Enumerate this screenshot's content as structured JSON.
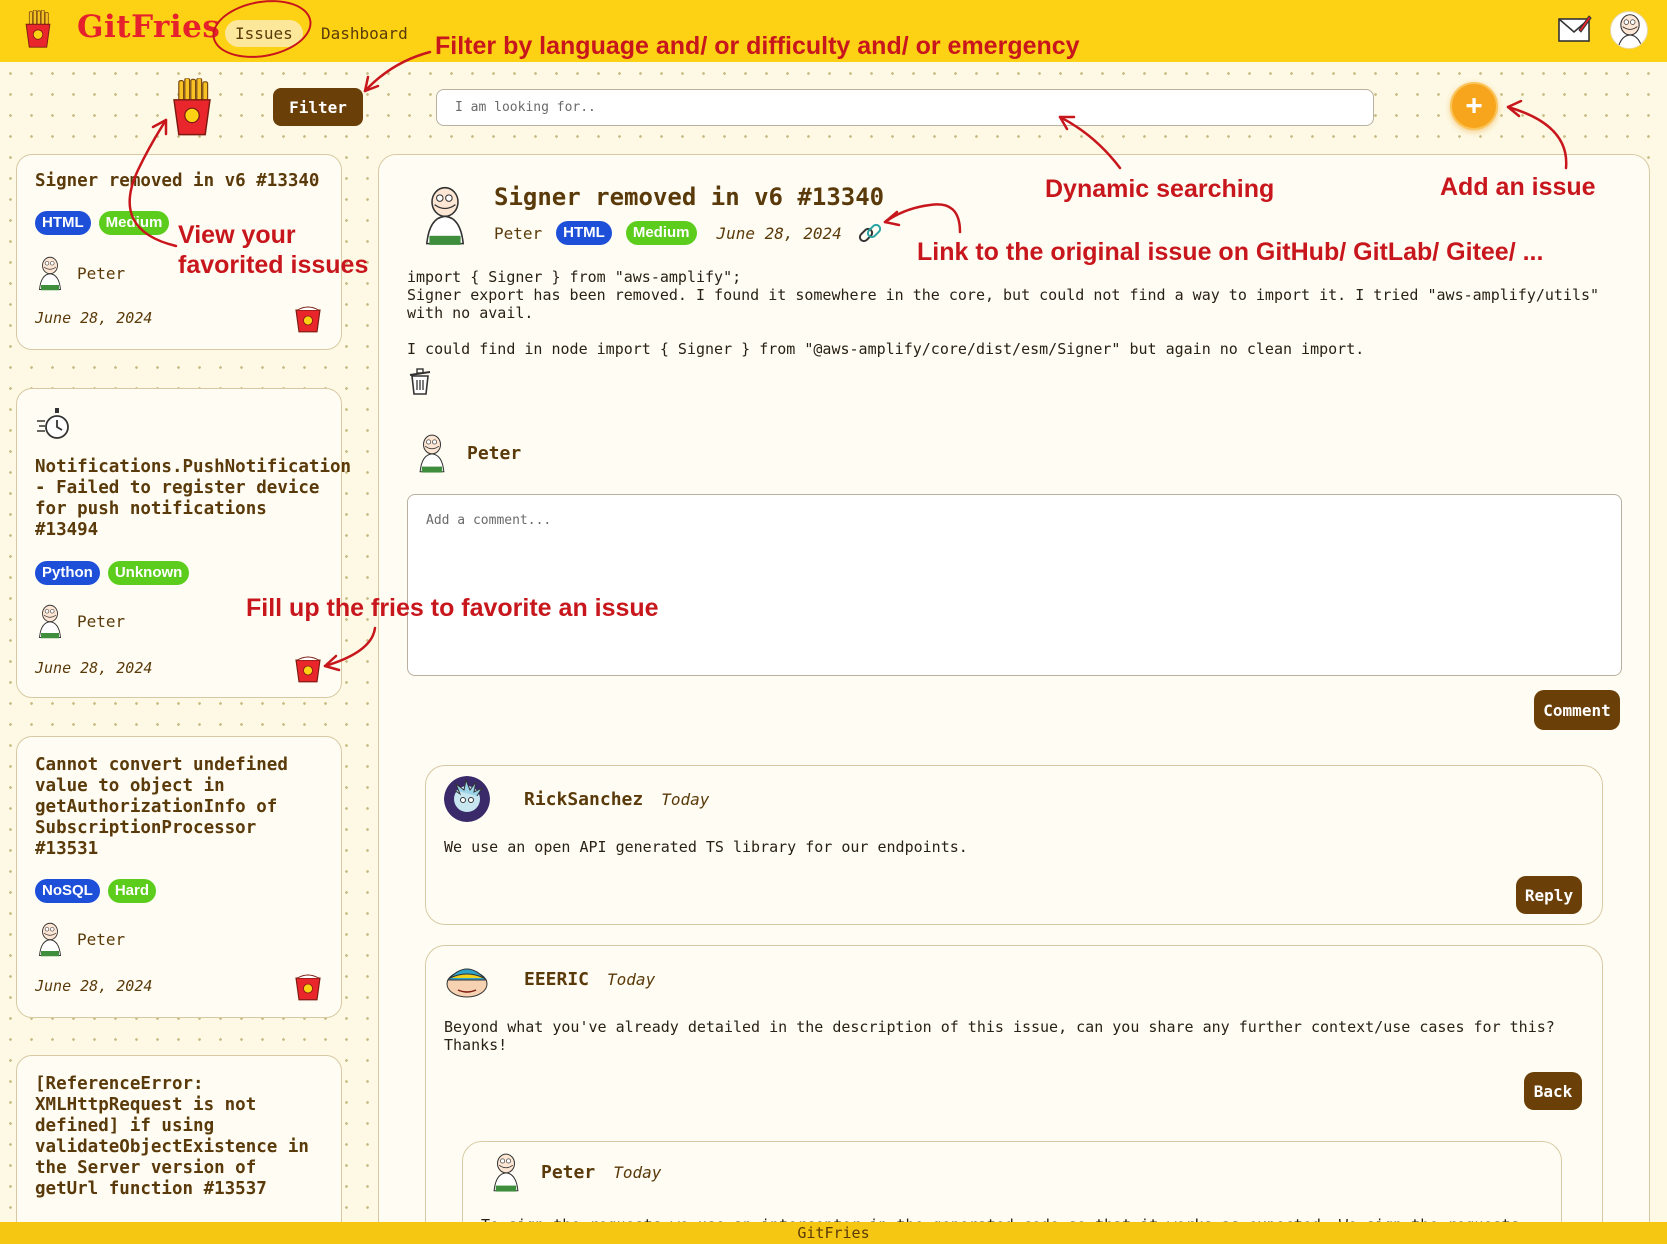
{
  "app": {
    "name": "GitFries"
  },
  "nav": {
    "tabs": [
      {
        "label": "Issues",
        "active": true
      },
      {
        "label": "Dashboard",
        "active": false
      }
    ]
  },
  "toolbar": {
    "filter_label": "Filter",
    "search_placeholder": "I am looking for..",
    "add_label": "+"
  },
  "issue_list": [
    {
      "title": "Signer removed in v6 #13340",
      "language": "HTML",
      "difficulty": "Medium",
      "author": "Peter",
      "date": "June 28, 2024"
    },
    {
      "title": "Notifications.PushNotification - Failed to register device for push notifications #13494",
      "language": "Python",
      "difficulty": "Unknown",
      "author": "Peter",
      "date": "June 28, 2024"
    },
    {
      "title": "Cannot convert undefined value to object in getAuthorizationInfo of SubscriptionProcessor #13531",
      "language": "NoSQL",
      "difficulty": "Hard",
      "author": "Peter",
      "date": "June 28, 2024"
    },
    {
      "title": "[ReferenceError: XMLHttpRequest is not defined] if using validateObjectExistence in the Server version of getUrl function #13537"
    }
  ],
  "issue": {
    "title": "Signer removed in v6 #13340",
    "author": "Peter",
    "language": "HTML",
    "difficulty": "Medium",
    "date": "June 28, 2024",
    "body": "import { Signer } from \"aws-amplify\";\nSigner export has been removed. I found it somewhere in the core, but could not find a way to import it. I tried \"aws-amplify/utils\"\nwith no avail.\n\nI could find in node import { Signer } from \"@aws-amplify/core/dist/esm/Signer\" but again no clean import."
  },
  "comment_form": {
    "user": "Peter",
    "placeholder": "Add a comment...",
    "submit_label": "Comment"
  },
  "comments": [
    {
      "author": "RickSanchez",
      "when": "Today",
      "text": "We use an open API generated TS library for our endpoints.",
      "action_label": "Reply"
    },
    {
      "author": "EEERIC",
      "when": "Today",
      "text": "Beyond what you've already detailed in the description of this issue, can you share any further context/use cases for this?\nThanks!",
      "action_label": "Back",
      "replies": [
        {
          "author": "Peter",
          "when": "Today",
          "text": "To sign the requests we use an interceptor in the generated code so that it works as expected. We sign the requests"
        }
      ]
    }
  ],
  "annotations": {
    "filter": "Filter by language and/ or difficulty and/ or emergency",
    "search": "Dynamic searching",
    "add": "Add an issue",
    "favorites_line1": "View your",
    "favorites_line2": "favorited issues",
    "link": "Link to the original issue on GitHub/ GitLab/ Gitee/ ...",
    "fill": "Fill up the fries to favorite an issue"
  },
  "footer": {
    "text": "GitFries"
  },
  "colors": {
    "topbar": "#fdd214",
    "brand_red": "#e5222b",
    "button_brown": "#6b3f08",
    "tag_blue": "#1d4fd9",
    "tag_green": "#5ccd1d",
    "add_orange": "#f7a51d",
    "annotation_red": "#c8161d"
  }
}
